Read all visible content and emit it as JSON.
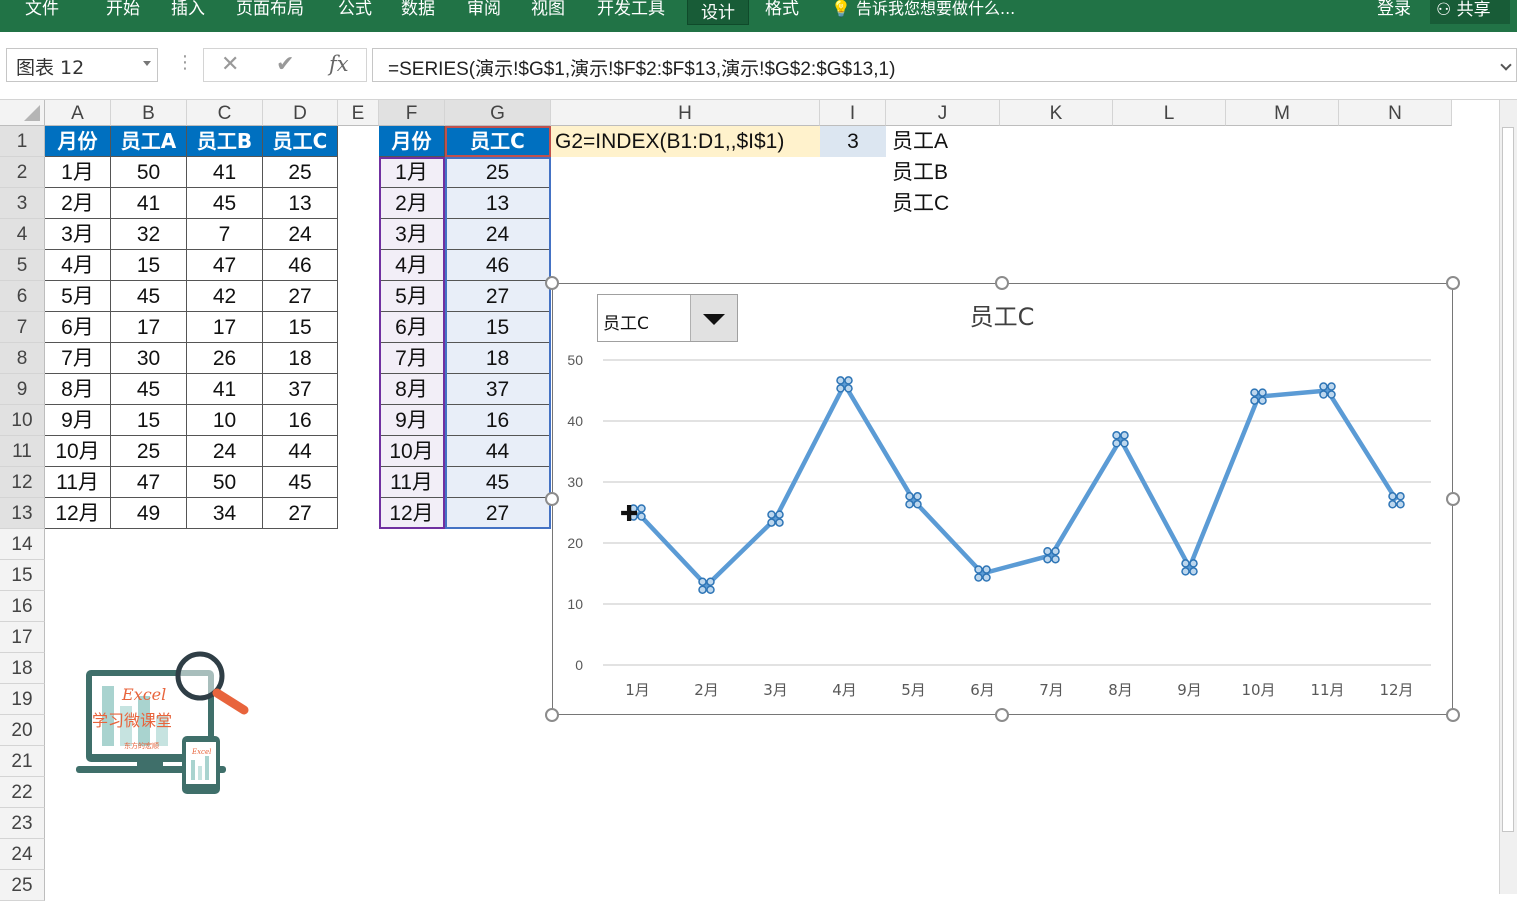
{
  "ribbon": {
    "tabs": [
      "文件",
      "开始",
      "插入",
      "页面布局",
      "公式",
      "数据",
      "审阅",
      "视图",
      "开发工具",
      "设计",
      "格式"
    ],
    "active_tab": "设计",
    "tellme": "告诉我您想要做什么...",
    "signin": "登录",
    "share": "共享"
  },
  "formula_bar": {
    "name_box": "图表 12",
    "cancel_glyph": "✕",
    "enter_glyph": "✔",
    "fx": "fx",
    "formula": "=SERIES(演示!$G$1,演示!$F$2:$F$13,演示!$G$2:$G$13,1)"
  },
  "columns": [
    "A",
    "B",
    "C",
    "D",
    "E",
    "F",
    "G",
    "H",
    "I",
    "J",
    "K",
    "L",
    "M",
    "N"
  ],
  "rows": [
    "1",
    "2",
    "3",
    "4",
    "5",
    "6",
    "7",
    "8",
    "9",
    "10",
    "11",
    "12",
    "13",
    "14",
    "15",
    "16",
    "17",
    "18",
    "19",
    "20",
    "21",
    "22",
    "23",
    "24",
    "25"
  ],
  "table1": {
    "headers": [
      "月份",
      "员工A",
      "员工B",
      "员工C"
    ],
    "rows": [
      [
        "1月",
        "50",
        "41",
        "25"
      ],
      [
        "2月",
        "41",
        "45",
        "13"
      ],
      [
        "3月",
        "32",
        "7",
        "24"
      ],
      [
        "4月",
        "15",
        "47",
        "46"
      ],
      [
        "5月",
        "45",
        "42",
        "27"
      ],
      [
        "6月",
        "17",
        "17",
        "15"
      ],
      [
        "7月",
        "30",
        "26",
        "18"
      ],
      [
        "8月",
        "45",
        "41",
        "37"
      ],
      [
        "9月",
        "15",
        "10",
        "16"
      ],
      [
        "10月",
        "25",
        "24",
        "44"
      ],
      [
        "11月",
        "47",
        "50",
        "45"
      ],
      [
        "12月",
        "49",
        "34",
        "27"
      ]
    ]
  },
  "table2": {
    "headers": [
      "月份",
      "员工C"
    ],
    "rows": [
      [
        "1月",
        "25"
      ],
      [
        "2月",
        "13"
      ],
      [
        "3月",
        "24"
      ],
      [
        "4月",
        "46"
      ],
      [
        "5月",
        "27"
      ],
      [
        "6月",
        "15"
      ],
      [
        "7月",
        "18"
      ],
      [
        "8月",
        "37"
      ],
      [
        "9月",
        "16"
      ],
      [
        "10月",
        "44"
      ],
      [
        "11月",
        "45"
      ],
      [
        "12月",
        "27"
      ]
    ]
  },
  "note_h1": "G2=INDEX(B1:D1,,$I$1)",
  "cell_i1": "3",
  "list_j": [
    "员工A",
    "员工B",
    "员工C"
  ],
  "logo": {
    "line1": "Excel",
    "line2": "学习微课堂",
    "line3": "东方的宏顺",
    "small": "Excel"
  },
  "combo": {
    "selected": "员工C"
  },
  "colors": {
    "ribbon": "#217346",
    "header_fill": "#0070c0",
    "series": "#5b9bd5",
    "note_fill": "#fff2cc",
    "i1_fill": "#dce6f1"
  },
  "chart_data": {
    "type": "line",
    "title": "员工C",
    "categories": [
      "1月",
      "2月",
      "3月",
      "4月",
      "5月",
      "6月",
      "7月",
      "8月",
      "9月",
      "10月",
      "11月",
      "12月"
    ],
    "series": [
      {
        "name": "员工C",
        "values": [
          25,
          13,
          24,
          46,
          27,
          15,
          18,
          37,
          16,
          44,
          45,
          27
        ]
      }
    ],
    "yticks": [
      "0",
      "10",
      "20",
      "30",
      "40",
      "50"
    ],
    "ylim": [
      0,
      50
    ],
    "grid": true,
    "legend": "none"
  }
}
